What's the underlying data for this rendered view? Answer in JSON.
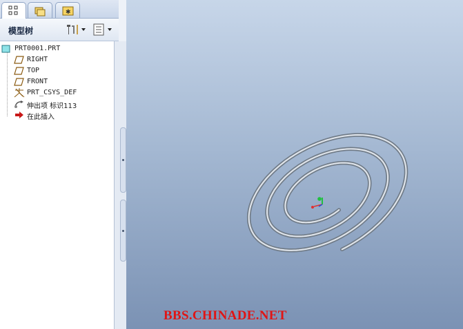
{
  "tabs": [
    {
      "name": "model-tree"
    },
    {
      "name": "folder-browser"
    },
    {
      "name": "favorites"
    }
  ],
  "tree_header": {
    "title": "模型树"
  },
  "tree": {
    "items": [
      {
        "label": "PRT0001.PRT",
        "icon": "part-icon"
      },
      {
        "label": "RIGHT",
        "icon": "datum-plane-icon"
      },
      {
        "label": "TOP",
        "icon": "datum-plane-icon"
      },
      {
        "label": "FRONT",
        "icon": "datum-plane-icon"
      },
      {
        "label": "PRT_CSYS_DEF",
        "icon": "csys-icon"
      },
      {
        "label": "伸出项 标识113",
        "icon": "protrusion-icon"
      },
      {
        "label": "在此插入",
        "icon": "insert-here-arrow-icon"
      }
    ]
  },
  "viewport": {
    "watermark": "BBS.CHINADE.NET",
    "background_top": "#c7d6e9",
    "background_bottom": "#7b92b4",
    "model": "spiral-sweep"
  },
  "colors": {
    "watermark": "#e01515",
    "axis_x": "#e03030",
    "axis_y": "#20c040",
    "axis_z": "#2050e0"
  }
}
